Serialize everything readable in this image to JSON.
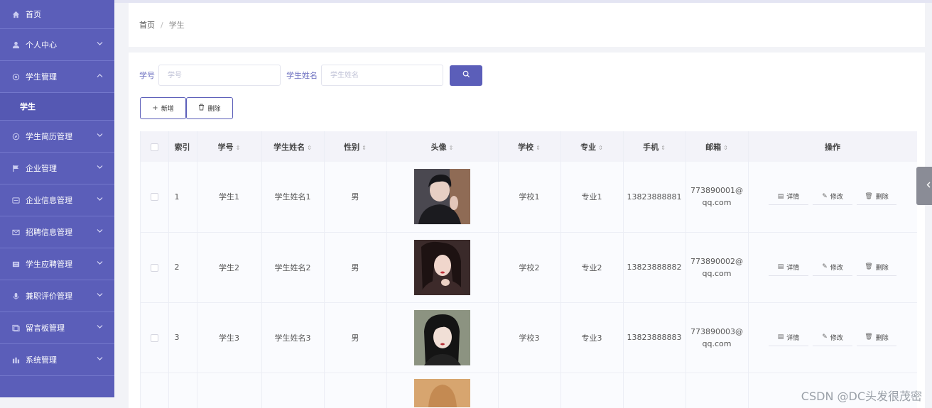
{
  "sidebar": {
    "items": [
      {
        "label": "首页",
        "icon": "home-icon",
        "chevron": ""
      },
      {
        "label": "个人中心",
        "icon": "user-icon",
        "chevron": "v"
      },
      {
        "label": "学生管理",
        "icon": "settings-icon",
        "chevron": "^"
      },
      {
        "label": "学生",
        "icon": "",
        "chevron": ""
      },
      {
        "label": "学生简历管理",
        "icon": "compass-icon",
        "chevron": "v"
      },
      {
        "label": "企业管理",
        "icon": "flag-icon",
        "chevron": "v"
      },
      {
        "label": "企业信息管理",
        "icon": "folder-icon",
        "chevron": "v"
      },
      {
        "label": "招聘信息管理",
        "icon": "mail-icon",
        "chevron": "v"
      },
      {
        "label": "学生应聘管理",
        "icon": "list-icon",
        "chevron": "v"
      },
      {
        "label": "兼职评价管理",
        "icon": "microphone-icon",
        "chevron": "v"
      },
      {
        "label": "留言板管理",
        "icon": "message-icon",
        "chevron": "v"
      },
      {
        "label": "系统管理",
        "icon": "chart-icon",
        "chevron": "v"
      }
    ]
  },
  "breadcrumb": {
    "home": "首页",
    "separator": "/",
    "current": "学生"
  },
  "search": {
    "field1_label": "学号",
    "field1_placeholder": "学号",
    "field2_label": "学生姓名",
    "field2_placeholder": "学生姓名"
  },
  "actions": {
    "add_label": "新增",
    "delete_label": "删除"
  },
  "table": {
    "columns": [
      "索引",
      "学号",
      "学生姓名",
      "性别",
      "头像",
      "学校",
      "专业",
      "手机",
      "邮箱",
      "操作"
    ],
    "rows": [
      {
        "index": "1",
        "student_no": "学生1",
        "name": "学生姓名1",
        "gender": "男",
        "school": "学校1",
        "major": "专业1",
        "phone": "13823888881",
        "email_1": "773890001@",
        "email_2": "qq.com"
      },
      {
        "index": "2",
        "student_no": "学生2",
        "name": "学生姓名2",
        "gender": "男",
        "school": "学校2",
        "major": "专业2",
        "phone": "13823888882",
        "email_1": "773890002@",
        "email_2": "qq.com"
      },
      {
        "index": "3",
        "student_no": "学生3",
        "name": "学生姓名3",
        "gender": "男",
        "school": "学校3",
        "major": "专业3",
        "phone": "13823888883",
        "email_1": "773890003@",
        "email_2": "qq.com"
      }
    ],
    "op_labels": {
      "detail": "详情",
      "edit": "修改",
      "delete": "删除"
    }
  },
  "watermark": "CSDN @DC头发很茂密",
  "colors": {
    "sidebar": "#5b5eb9",
    "accent": "#5b5eb9",
    "header_bg": "#f3f3f9"
  }
}
